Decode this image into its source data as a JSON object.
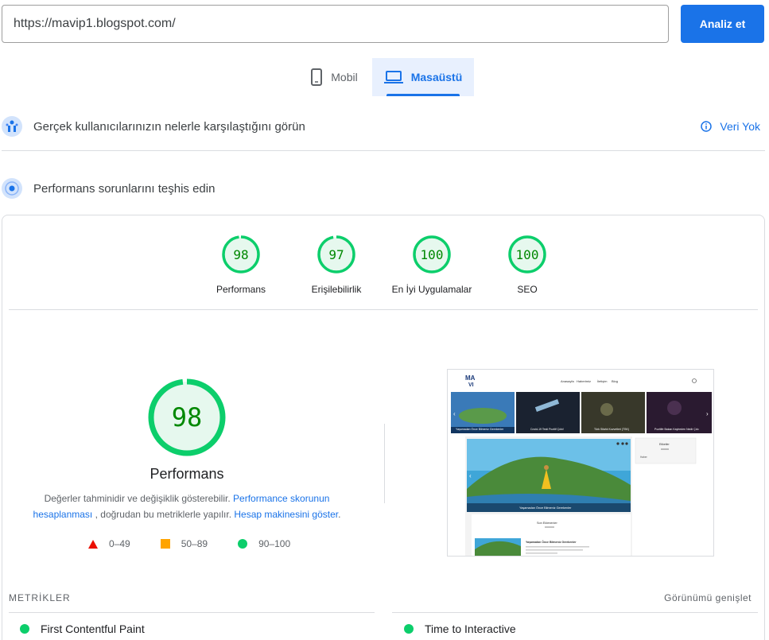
{
  "search": {
    "url": "https://mavip1.blogspot.com/",
    "analyze_label": "Analiz et"
  },
  "tabs": [
    {
      "label": "Mobil",
      "icon": "mobile-icon",
      "active": false
    },
    {
      "label": "Masaüstü",
      "icon": "laptop-icon",
      "active": true
    }
  ],
  "real_users": {
    "title": "Gerçek kullanıcılarınızın nelerle karşılaştığını görün",
    "no_data": "Veri Yok"
  },
  "diagnose": {
    "title": "Performans sorunlarını teşhis edin"
  },
  "scores": [
    {
      "value": "98",
      "label": "Performans",
      "fraction": 0.98
    },
    {
      "value": "97",
      "label": "Erişilebilirlik",
      "fraction": 0.97
    },
    {
      "value": "100",
      "label": "En İyi Uygulamalar",
      "fraction": 1.0
    },
    {
      "value": "100",
      "label": "SEO",
      "fraction": 1.0
    }
  ],
  "main_score": {
    "value": "98",
    "fraction": 0.98,
    "title": "Performans",
    "desc_prefix": "Değerler tahminidir ve değişiklik gösterebilir. ",
    "link1": "Performance skorunun hesaplanması",
    "desc_middle": " , doğrudan bu metriklerle yapılır. ",
    "link2": "Hesap makinesini göster",
    "desc_suffix": "."
  },
  "legend": [
    {
      "range": "0–49",
      "color": "#eb0f00"
    },
    {
      "range": "50–89",
      "color": "#ffa400"
    },
    {
      "range": "90–100",
      "color": "#0cce6b"
    }
  ],
  "screenshot": {
    "nav": [
      "Anasayfa",
      "Haberimiz",
      "İletişim",
      "Blog"
    ],
    "slides": [
      "Yaşamadan Önce Bilmeniz Gerekenler",
      "Covid-19 Testi Pozitif Çıktı!",
      "Türk Silahlı Kuvvetleri (TSK)",
      "Pozitife Bakan Kaybeden Nedir Çıkı"
    ],
    "hero_caption": "Yaşamadan Önce Bilmeniz Gerekenler",
    "sidebar_title": "Etiketler",
    "sidebar_item": "Haber",
    "recent_title": "Son Eklenenler",
    "recent_item": "Yaşamadan Önce Bilmeniz Gerekenler"
  },
  "metrics": {
    "label": "METRİKLER",
    "expand": "Görünümü genişlet",
    "items": [
      "First Contentful Paint",
      "Time to Interactive"
    ]
  },
  "colors": {
    "accent": "#1a73e8",
    "pass": "#0cce6b",
    "pass_text": "#008800",
    "pass_bg": "#e6f8ee"
  }
}
